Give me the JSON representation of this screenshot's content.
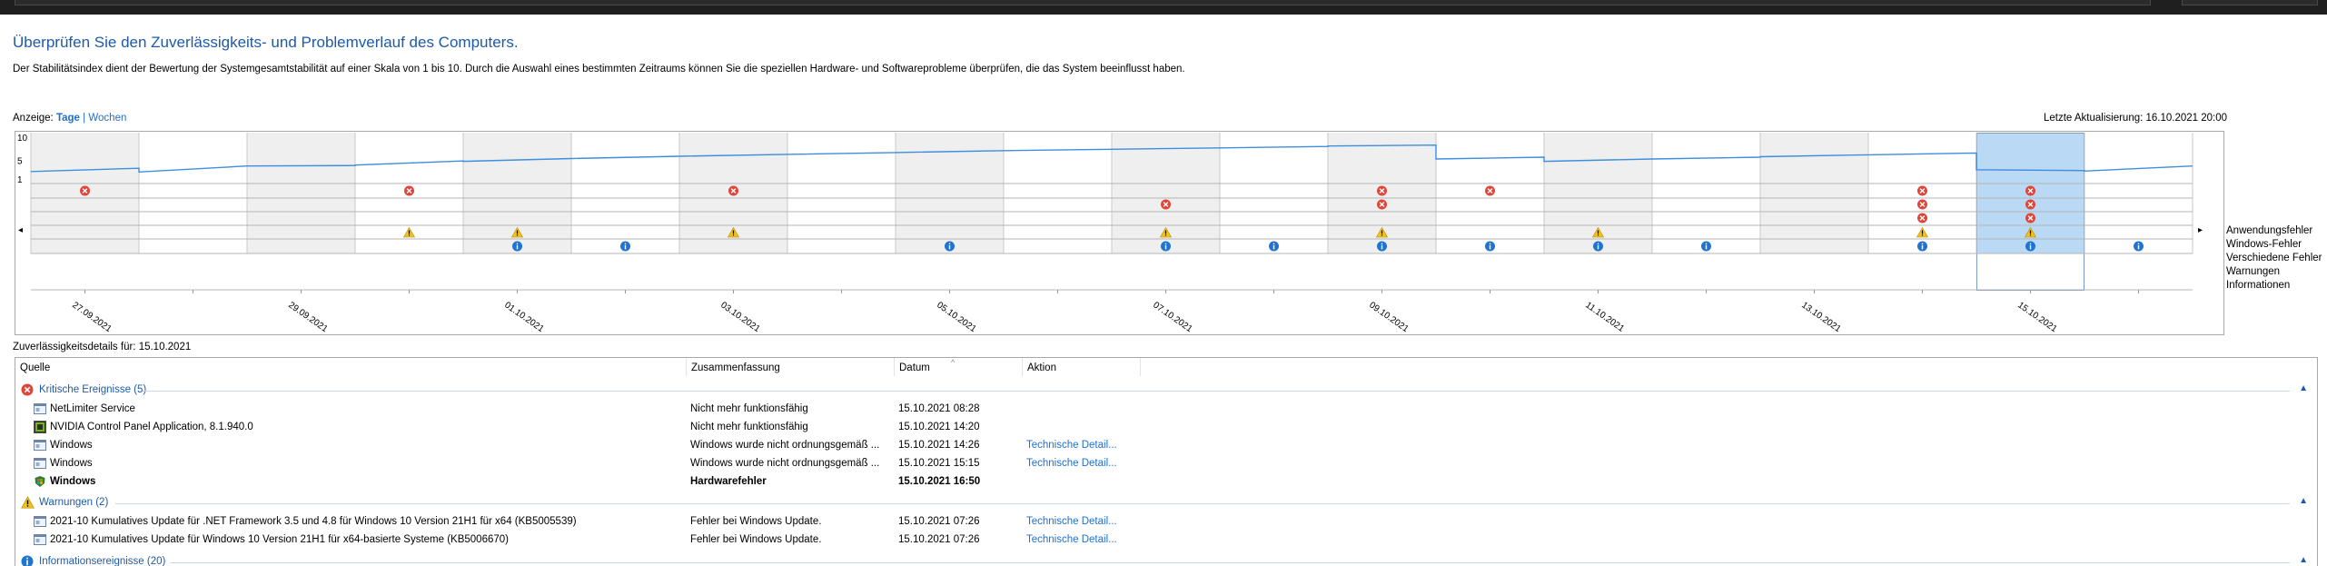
{
  "heading": "Überprüfen Sie den Zuverlässigkeits- und Problemverlauf des Computers.",
  "intro": "Der Stabilitätsindex dient der Bewertung der Systemgesamtstabilität auf einer Skala von 1 bis 10. Durch die Auswahl eines bestimmten Zeitraums können Sie die speziellen Hardware- und Softwareprobleme überprüfen, die das System beeinflusst haben.",
  "view": {
    "label": "Anzeige:",
    "days": "Tage",
    "separator": "|",
    "weeks": "Wochen"
  },
  "last_update": "Letzte Aktualisierung: 16.10.2021 20:00",
  "chart_data": {
    "type": "line",
    "y_ticks": [
      "10",
      "5",
      "1"
    ],
    "ylim": [
      1,
      10
    ],
    "columns": 20,
    "selected_column": 18,
    "date_labels": [
      {
        "col": 0,
        "text": "27.09.2021"
      },
      {
        "col": 2,
        "text": "29.09.2021"
      },
      {
        "col": 4,
        "text": "01.10.2021"
      },
      {
        "col": 6,
        "text": "03.10.2021"
      },
      {
        "col": 8,
        "text": "05.10.2021"
      },
      {
        "col": 10,
        "text": "07.10.2021"
      },
      {
        "col": 12,
        "text": "09.10.2021"
      },
      {
        "col": 14,
        "text": "11.10.2021"
      },
      {
        "col": 16,
        "text": "13.10.2021"
      },
      {
        "col": 18,
        "text": "15.10.2021"
      }
    ],
    "stability_index": [
      {
        "col": 0,
        "start": 2.6,
        "end": 3.3
      },
      {
        "col": 1,
        "start": 2.5,
        "end": 3.8
      },
      {
        "col": 2,
        "start": 3.8,
        "end": 3.9
      },
      {
        "col": 3,
        "start": 4.0,
        "end": 4.9
      },
      {
        "col": 4,
        "start": 4.8,
        "end": 5.4
      },
      {
        "col": 5,
        "start": 5.4,
        "end": 5.9
      },
      {
        "col": 6,
        "start": 5.9,
        "end": 6.3
      },
      {
        "col": 7,
        "start": 6.3,
        "end": 6.7
      },
      {
        "col": 8,
        "start": 6.7,
        "end": 7.1
      },
      {
        "col": 9,
        "start": 7.1,
        "end": 7.4
      },
      {
        "col": 10,
        "start": 7.4,
        "end": 7.7
      },
      {
        "col": 11,
        "start": 7.7,
        "end": 8.0
      },
      {
        "col": 12,
        "start": 8.1,
        "end": 8.3
      },
      {
        "col": 13,
        "start": 5.3,
        "end": 5.7
      },
      {
        "col": 14,
        "start": 4.8,
        "end": 5.3
      },
      {
        "col": 15,
        "start": 5.3,
        "end": 5.7
      },
      {
        "col": 16,
        "start": 5.8,
        "end": 6.2
      },
      {
        "col": 17,
        "start": 6.2,
        "end": 6.6
      },
      {
        "col": 18,
        "start": 3.0,
        "end": 2.8
      },
      {
        "col": 19,
        "start": 2.7,
        "end": 3.8
      }
    ],
    "legend_categories": [
      "Anwendungsfehler",
      "Windows-Fehler",
      "Verschiedene Fehler",
      "Warnungen",
      "Informationen"
    ],
    "events": [
      {
        "col": 0,
        "cat": 0,
        "kind": "error"
      },
      {
        "col": 3,
        "cat": 0,
        "kind": "error"
      },
      {
        "col": 6,
        "cat": 0,
        "kind": "error"
      },
      {
        "col": 12,
        "cat": 0,
        "kind": "error"
      },
      {
        "col": 13,
        "cat": 0,
        "kind": "error"
      },
      {
        "col": 17,
        "cat": 0,
        "kind": "error"
      },
      {
        "col": 18,
        "cat": 0,
        "kind": "error"
      },
      {
        "col": 10,
        "cat": 1,
        "kind": "error"
      },
      {
        "col": 12,
        "cat": 1,
        "kind": "error"
      },
      {
        "col": 17,
        "cat": 1,
        "kind": "error"
      },
      {
        "col": 18,
        "cat": 1,
        "kind": "error"
      },
      {
        "col": 17,
        "cat": 2,
        "kind": "error"
      },
      {
        "col": 18,
        "cat": 2,
        "kind": "error"
      },
      {
        "col": 3,
        "cat": 3,
        "kind": "warning"
      },
      {
        "col": 4,
        "cat": 3,
        "kind": "warning"
      },
      {
        "col": 6,
        "cat": 3,
        "kind": "warning"
      },
      {
        "col": 10,
        "cat": 3,
        "kind": "warning"
      },
      {
        "col": 12,
        "cat": 3,
        "kind": "warning"
      },
      {
        "col": 14,
        "cat": 3,
        "kind": "warning"
      },
      {
        "col": 17,
        "cat": 3,
        "kind": "warning"
      },
      {
        "col": 18,
        "cat": 3,
        "kind": "warning"
      },
      {
        "col": 4,
        "cat": 4,
        "kind": "info"
      },
      {
        "col": 5,
        "cat": 4,
        "kind": "info"
      },
      {
        "col": 8,
        "cat": 4,
        "kind": "info"
      },
      {
        "col": 10,
        "cat": 4,
        "kind": "info"
      },
      {
        "col": 11,
        "cat": 4,
        "kind": "info"
      },
      {
        "col": 12,
        "cat": 4,
        "kind": "info"
      },
      {
        "col": 13,
        "cat": 4,
        "kind": "info"
      },
      {
        "col": 14,
        "cat": 4,
        "kind": "info"
      },
      {
        "col": 15,
        "cat": 4,
        "kind": "info"
      },
      {
        "col": 17,
        "cat": 4,
        "kind": "info"
      },
      {
        "col": 18,
        "cat": 4,
        "kind": "info"
      },
      {
        "col": 19,
        "cat": 4,
        "kind": "info"
      }
    ]
  },
  "details_title": "Zuverlässigkeitsdetails für: 15.10.2021",
  "columns": {
    "source": "Quelle",
    "summary": "Zusammenfassung",
    "date": "Datum",
    "action": "Aktion"
  },
  "groups": {
    "critical": {
      "label": "Kritische Ereignisse (5)",
      "rows": [
        {
          "source": "NetLimiter Service",
          "summary": "Nicht mehr funktionsfähig",
          "date": "15.10.2021 08:28",
          "action": "",
          "bold": false
        },
        {
          "source": "NVIDIA Control Panel Application, 8.1.940.0",
          "summary": "Nicht mehr funktionsfähig",
          "date": "15.10.2021 14:20",
          "action": "",
          "bold": false
        },
        {
          "source": "Windows",
          "summary": "Windows wurde nicht ordnungsgemäß ...",
          "date": "15.10.2021 14:26",
          "action": "Technische Detail...",
          "bold": false
        },
        {
          "source": "Windows",
          "summary": "Windows wurde nicht ordnungsgemäß ...",
          "date": "15.10.2021 15:15",
          "action": "Technische Detail...",
          "bold": false
        },
        {
          "source": "Windows",
          "summary": "Hardwarefehler",
          "date": "15.10.2021 16:50",
          "action": "",
          "bold": true
        }
      ]
    },
    "warnings": {
      "label": "Warnungen (2)",
      "rows": [
        {
          "source": "2021-10 Kumulatives Update für .NET Framework 3.5 und 4.8 für Windows 10 Version 21H1 für x64 (KB5005539)",
          "summary": "Fehler bei Windows Update.",
          "date": "15.10.2021 07:26",
          "action": "Technische Detail...",
          "bold": false
        },
        {
          "source": "2021-10 Kumulatives Update für Windows 10 Version 21H1 für x64-basierte Systeme (KB5006670)",
          "summary": "Fehler bei Windows Update.",
          "date": "15.10.2021 07:26",
          "action": "Technische Detail...",
          "bold": false
        }
      ]
    },
    "info": {
      "label": "Informationsereignisse (20)"
    }
  },
  "colors": {
    "heading": "#1e5aa8",
    "link": "#1e6fd0",
    "line": "#3b8ee0",
    "error": "#e0453a",
    "warning": "#f2c21b",
    "info": "#1f73d1",
    "shaded_col": "#efefef",
    "selected_col": "#b9d9f5"
  }
}
